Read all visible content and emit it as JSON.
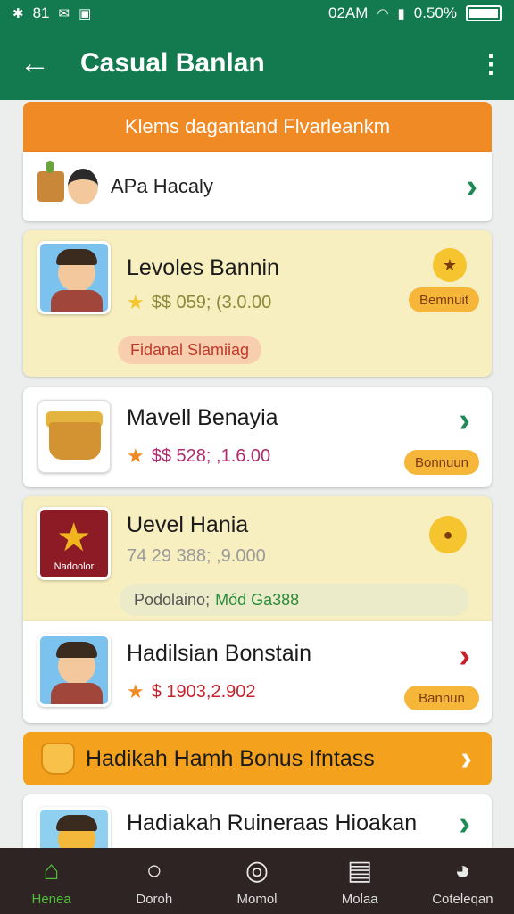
{
  "status_bar": {
    "left": "81",
    "time": "02AM",
    "battery": "0.50%"
  },
  "app_bar": {
    "title": "Casual Banlan"
  },
  "banner": {
    "text": "Klems dagantand Flvarleankm"
  },
  "simple_row": {
    "label": "APa Hacaly"
  },
  "items": [
    {
      "title": "Levoles Bannin",
      "price": "$$ 059; (3.0.00",
      "pill": "Bemnuit",
      "tag": "Fidanal Slamiiag"
    },
    {
      "title": "Mavell Benayia",
      "price": "$$ 528; ,1.6.00",
      "pill": "Bonnuun"
    },
    {
      "title": "Uevel Hania",
      "price": "74 29 388; ,9.000",
      "thumb_caption": "Nadoolor",
      "tag_key": "Podolaino;",
      "tag_value": "Mód Ga388"
    },
    {
      "title": "Hadilsian Bonstain",
      "price": "$ 1903,2.902",
      "pill": "Bannun"
    }
  ],
  "bonus_bar": {
    "label": "Hadikah Hamh Bonus Ifntass"
  },
  "last_item": {
    "title": "Hadiakah Ruineraas Hioakan"
  },
  "nav": [
    {
      "label": "Henea",
      "icon": "home-icon",
      "active": true
    },
    {
      "label": "Doroh",
      "icon": "search-icon"
    },
    {
      "label": "Momol",
      "icon": "target-icon"
    },
    {
      "label": "Molaa",
      "icon": "box-icon"
    },
    {
      "label": "Coteleqan",
      "icon": "bear-icon"
    }
  ],
  "colors": {
    "primary": "#137a4f",
    "accent": "#f08a24",
    "nav_bg": "#2e2424",
    "active_nav": "#4fbf3a"
  }
}
